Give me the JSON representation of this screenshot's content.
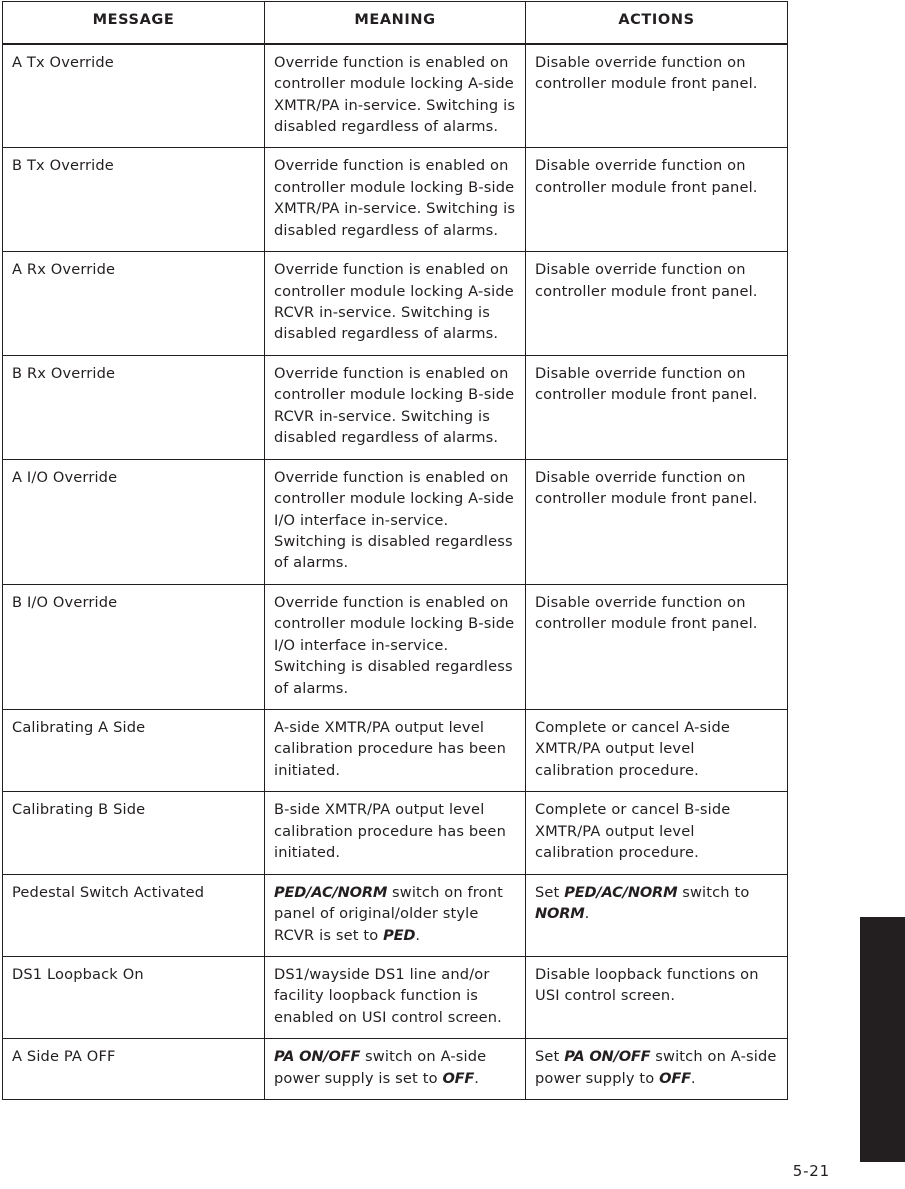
{
  "document": {
    "page_number": "5-21"
  },
  "table": {
    "headers": [
      "MESSAGE",
      "MEANING",
      "ACTIONS"
    ],
    "rows": [
      {
        "message": "A Tx Override",
        "meaning": "Override function is enabled on controller module locking A-side XMTR/PA in-service. Switching is disabled regardless of alarms.",
        "actions": "Disable override function on controller module front panel."
      },
      {
        "message": "B Tx Override",
        "meaning": "Override function is enabled on controller module locking B-side XMTR/PA in-service. Switching is disabled regardless of alarms.",
        "actions": "Disable override function on controller module front panel."
      },
      {
        "message": "A Rx Override",
        "meaning": "Override function is enabled on controller module locking A-side RCVR in-service. Switching is disabled regardless of alarms.",
        "actions": "Disable override function on controller module front panel."
      },
      {
        "message": "B Rx Override",
        "meaning": "Override function is enabled on controller module locking B-side RCVR in-service. Switching is disabled regardless of alarms.",
        "actions": "Disable override function on controller module front panel."
      },
      {
        "message": "A I/O Override",
        "meaning": "Override function is enabled on controller module locking A-side I/O interface in-service. Switching is disabled regardless of alarms.",
        "actions": "Disable override function on controller module front panel."
      },
      {
        "message": "B I/O Override",
        "meaning": "Override function is enabled on controller module locking B-side I/O interface in-service. Switching is disabled regardless of alarms.",
        "actions": "Disable override function on controller module front panel."
      },
      {
        "message": "Calibrating A Side",
        "meaning": "A-side XMTR/PA output level calibration procedure has been initiated.",
        "actions": "Complete or cancel A-side XMTR/PA output level calibration procedure."
      },
      {
        "message": "Calibrating B Side",
        "meaning": "B-side XMTR/PA output level calibration procedure has been initiated.",
        "actions": "Complete or cancel B-side XMTR/PA output level calibration procedure."
      },
      {
        "message": "Pedestal Switch Activated",
        "meaning_html": "<b class=\"emph\">PED/AC/NORM</b> switch on front panel of original/older style RCVR is set to <b class=\"emph\">PED</b>.",
        "actions_html": "Set <b class=\"emph\">PED/AC/NORM</b> switch to <b class=\"emph\">NORM</b>."
      },
      {
        "message": "DS1 Loopback On",
        "meaning": "DS1/wayside DS1 line and/or facility loopback function is enabled on USI control screen.",
        "actions": "Disable loopback functions on USI control screen."
      },
      {
        "message": "A Side PA OFF",
        "meaning_html": "<b class=\"emph\">PA ON/OFF</b> switch on A-side power supply is set to <b class=\"emph\">OFF</b>.",
        "actions_html": "Set <b class=\"emph\">PA ON/OFF</b> switch on A-side power supply to <b class=\"emph\">OFF</b>."
      }
    ]
  },
  "colors": {
    "ink": "#231f20",
    "paper": "#ffffff",
    "tab": "#231f20"
  }
}
